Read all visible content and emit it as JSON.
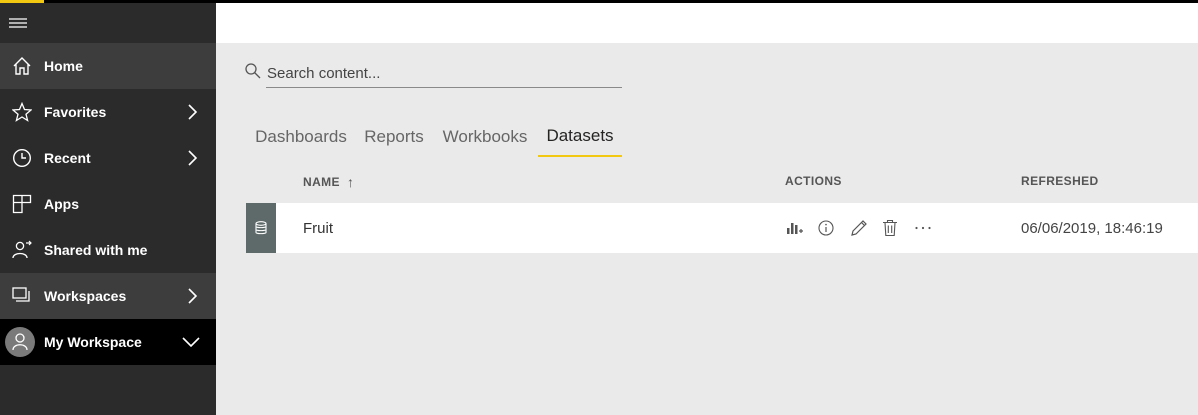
{
  "sidebar": {
    "items": [
      {
        "label": "Home",
        "icon": "home-icon"
      },
      {
        "label": "Favorites",
        "icon": "star-icon",
        "chevron": "right"
      },
      {
        "label": "Recent",
        "icon": "clock-icon",
        "chevron": "right"
      },
      {
        "label": "Apps",
        "icon": "apps-icon"
      },
      {
        "label": "Shared with me",
        "icon": "shared-icon"
      },
      {
        "label": "Workspaces",
        "icon": "workspaces-icon",
        "chevron": "right"
      },
      {
        "label": "My Workspace",
        "icon": "avatar",
        "chevron": "down"
      }
    ]
  },
  "search": {
    "placeholder": "Search content..."
  },
  "tabs": [
    {
      "label": "Dashboards"
    },
    {
      "label": "Reports"
    },
    {
      "label": "Workbooks"
    },
    {
      "label": "Datasets",
      "active": true
    }
  ],
  "table": {
    "columns": {
      "name": "NAME",
      "actions": "ACTIONS",
      "refreshed": "REFRESHED"
    },
    "sort_indicator": "↑",
    "rows": [
      {
        "name": "Fruit",
        "refreshed": "06/06/2019, 18:46:19",
        "actions": [
          "create-report-icon",
          "info-icon",
          "edit-icon",
          "delete-icon",
          "more-icon"
        ]
      }
    ]
  },
  "colors": {
    "accent": "#f2c811",
    "sidebar": "#2b2b2b",
    "row_icon_bg": "#5e6a6a"
  }
}
